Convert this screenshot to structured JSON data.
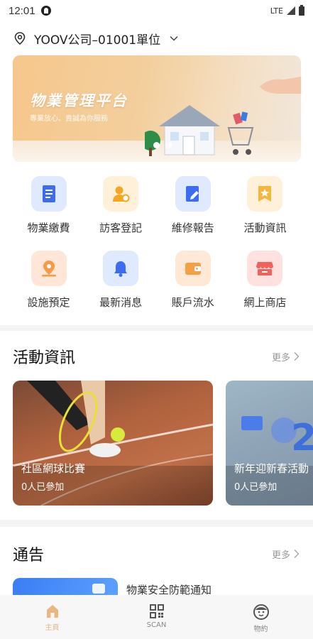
{
  "status_bar": {
    "time": "12:01",
    "network": "LTE"
  },
  "header": {
    "location": "YOOV公司–01001單位"
  },
  "banner": {
    "title": "物業管理平台",
    "subtitle": "專業放心、貴誠為你服務"
  },
  "services": [
    {
      "label": "物業繳費",
      "icon": "document-icon",
      "bg": "#dfe9ff",
      "fg": "#3c6df0"
    },
    {
      "label": "訪客登記",
      "icon": "visitor-icon",
      "bg": "#fff1d9",
      "fg": "#f5a623"
    },
    {
      "label": "維修報告",
      "icon": "repair-icon",
      "bg": "#dfe9ff",
      "fg": "#3c6df0"
    },
    {
      "label": "活動資訊",
      "icon": "star-icon",
      "bg": "#fff1d9",
      "fg": "#f5b640"
    },
    {
      "label": "設施預定",
      "icon": "location-pin-icon",
      "bg": "#ffe6d6",
      "fg": "#f59a45"
    },
    {
      "label": "最新消息",
      "icon": "bell-icon",
      "bg": "#dfe9ff",
      "fg": "#3c6df0"
    },
    {
      "label": "賬戶流水",
      "icon": "wallet-icon",
      "bg": "#ffe9d6",
      "fg": "#f5a045"
    },
    {
      "label": "網上商店",
      "icon": "store-icon",
      "bg": "#ffe2df",
      "fg": "#f2625a"
    }
  ],
  "activities": {
    "title": "活動資訊",
    "more": "更多",
    "cards": [
      {
        "name": "社區網球比賽",
        "count": "0人已參加"
      },
      {
        "name": "新年迎新春活動",
        "count": "0人已參加"
      }
    ]
  },
  "notices": {
    "title": "通告",
    "more": "更多",
    "items": [
      {
        "title": "物業安全防範通知"
      }
    ]
  },
  "tabs": [
    {
      "label": "主頁",
      "icon": "home-icon",
      "active": true
    },
    {
      "label": "SCAN",
      "icon": "qr-code-icon",
      "active": false
    },
    {
      "label": "物約",
      "icon": "smiley-icon",
      "active": false
    }
  ],
  "colors": {
    "accent": "#e7b882",
    "primary_blue": "#3c6df0"
  }
}
